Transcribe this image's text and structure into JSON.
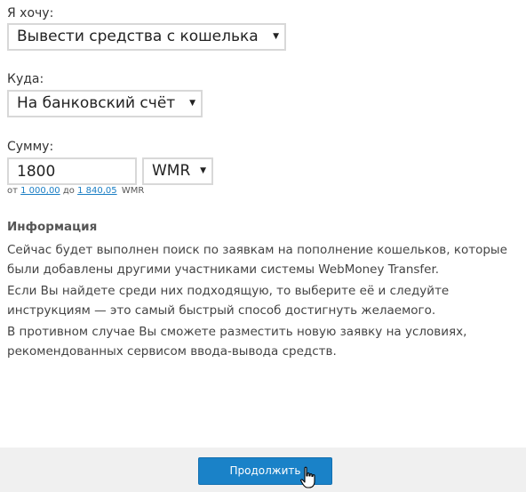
{
  "form": {
    "action": {
      "label": "Я хочу:",
      "selected": "Вывести средства с кошелька"
    },
    "destination": {
      "label": "Куда:",
      "selected": "На банковский счёт"
    },
    "amount": {
      "label": "Сумму:",
      "value": "1800",
      "currency": "WMR",
      "range": {
        "from_label": "от",
        "min": "1 000,00",
        "to_label": "до",
        "max": "1 840,05",
        "currency": "WMR"
      }
    }
  },
  "info": {
    "title": "Информация",
    "paragraphs": [
      "Сейчас будет выполнен поиск по заявкам на пополнение кошельков, которые были добавлены другими участниками системы WebMoney Transfer.",
      "Если Вы найдете среди них подходящую, то выберите её и следуйте инструкциям — это самый быстрый способ достигнуть желаемого.",
      "В противном случае Вы сможете разместить новую заявку на условиях, рекомендованных сервисом ввода-вывода средств."
    ]
  },
  "footer": {
    "continue_label": "Продолжить"
  },
  "icons": {
    "caret": "caret-down-icon",
    "cursor": "hand-pointer-icon"
  },
  "colors": {
    "button": "#1a82c8",
    "link": "#1a7ec4",
    "footer_bg": "#f0f0f0"
  }
}
